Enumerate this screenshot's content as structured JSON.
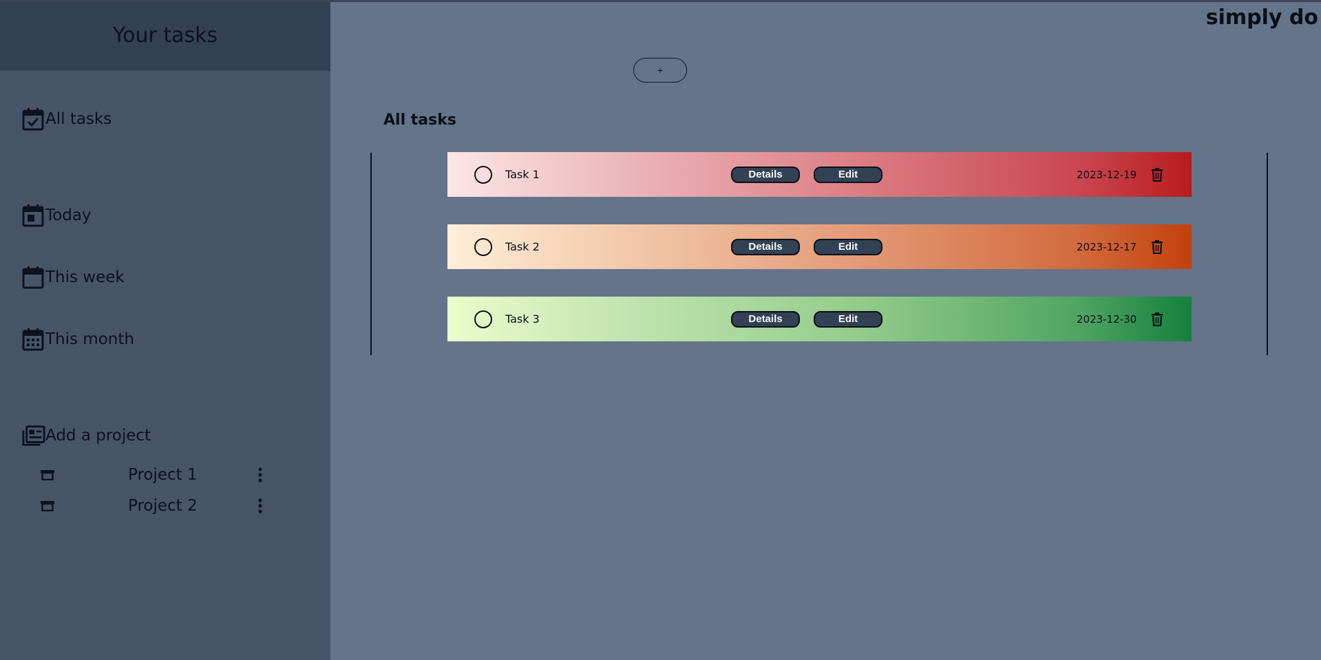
{
  "sidebar": {
    "title": "Your tasks",
    "nav": [
      {
        "label": "All tasks",
        "icon": "calendar-check-icon"
      },
      {
        "label": "Today",
        "icon": "calendar-today-icon"
      },
      {
        "label": "This week",
        "icon": "calendar-week-icon"
      },
      {
        "label": "This month",
        "icon": "calendar-month-icon"
      }
    ],
    "add_project": {
      "label": "Add a project",
      "icon": "newspaper-icon"
    },
    "projects": [
      {
        "label": "Project 1",
        "icon": "archive-icon",
        "menu_icon": "kebab-menu-icon"
      },
      {
        "label": "Project 2",
        "icon": "archive-icon",
        "menu_icon": "kebab-menu-icon"
      }
    ]
  },
  "header": {
    "brand": "simply do",
    "add_button_label": "+"
  },
  "main": {
    "section_title": "All tasks",
    "tasks": [
      {
        "name": "Task 1",
        "date": "2023-12-19",
        "details_label": "Details",
        "edit_label": "Edit",
        "priority_color": "#b91c1c"
      },
      {
        "name": "Task 2",
        "date": "2023-12-17",
        "details_label": "Details",
        "edit_label": "Edit",
        "priority_color": "#c2410c"
      },
      {
        "name": "Task 3",
        "date": "2023-12-30",
        "details_label": "Details",
        "edit_label": "Edit",
        "priority_color": "#15803d"
      }
    ]
  },
  "colors": {
    "background": "#64748b",
    "sidebar": "#475569",
    "sidebar_header": "#334155",
    "button": "#334155"
  }
}
